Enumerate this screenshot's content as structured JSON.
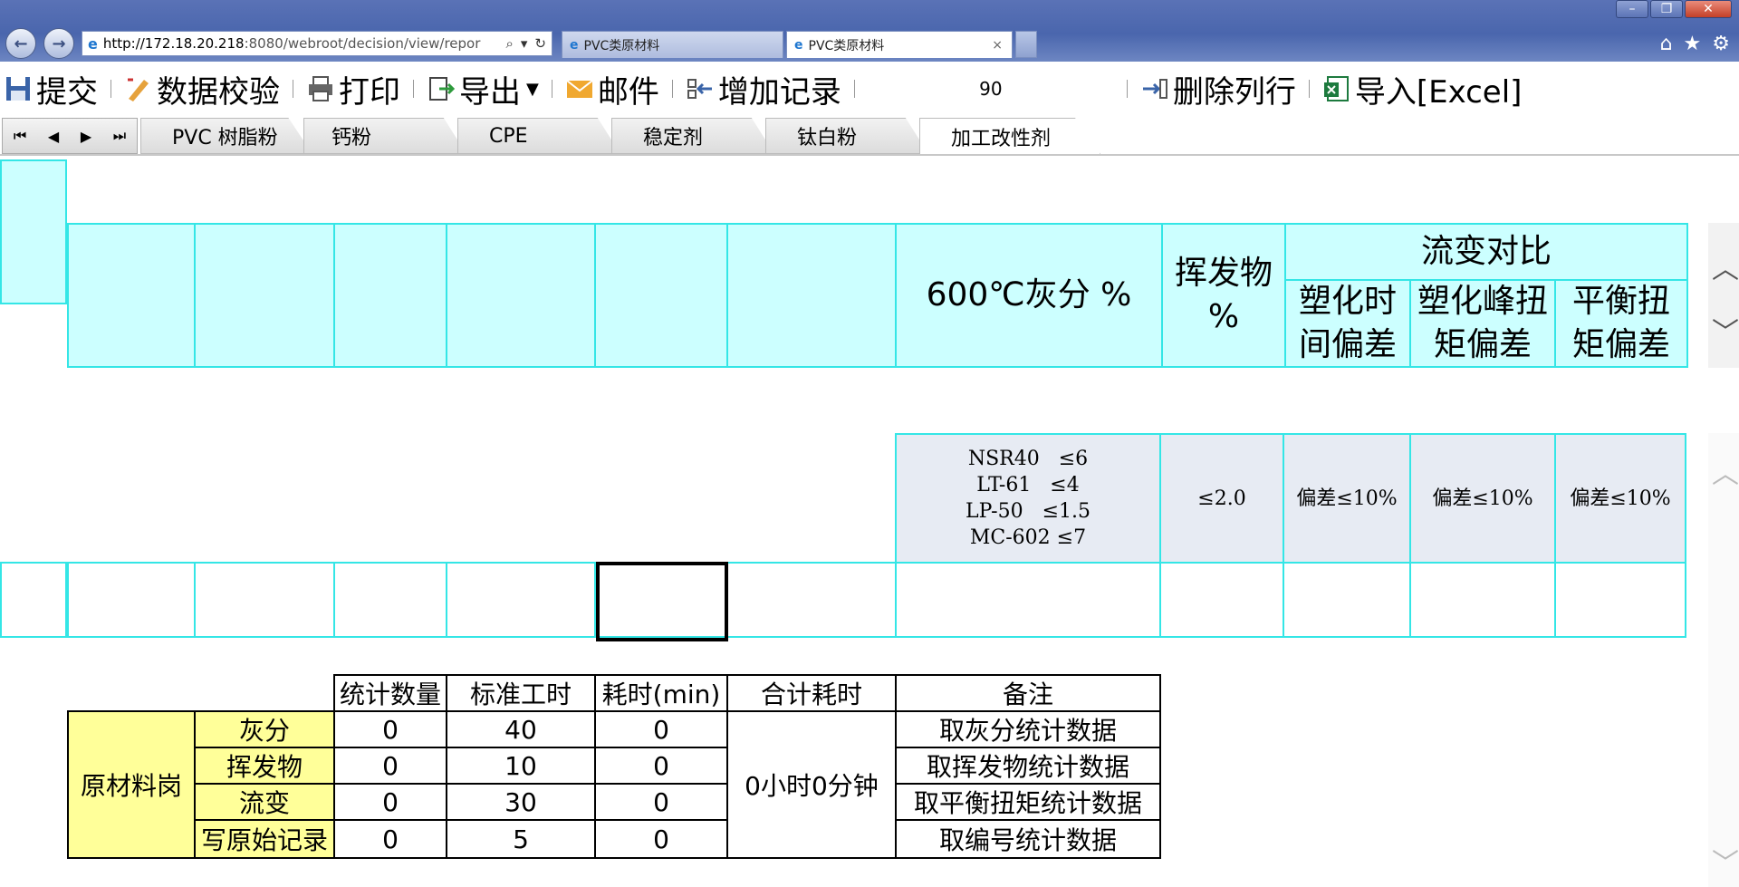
{
  "browser": {
    "address_url_host": "http://172.18.20.218",
    "address_url_rest": ":8080/webroot/decision/view/repor",
    "tabs": [
      {
        "title": "PVC类原材料"
      },
      {
        "title": "PVC类原材料"
      }
    ],
    "close_glyph": "×"
  },
  "toolbar": {
    "submit": "提交",
    "validate": "数据校验",
    "print": "打印",
    "export": "导出",
    "mail": "邮件",
    "add_record": "增加记录",
    "zoom_value": "90",
    "delete_row": "删除列行",
    "import_excel": "导入[Excel]"
  },
  "sheet_tabs": [
    {
      "label": "PVC 树脂粉",
      "active": false
    },
    {
      "label": "钙粉",
      "active": false
    },
    {
      "label": "CPE",
      "active": false
    },
    {
      "label": "稳定剂",
      "active": false
    },
    {
      "label": "钛白粉",
      "active": false
    },
    {
      "label": "加工改性剂",
      "active": true
    }
  ],
  "grid": {
    "header": {
      "ash": "600℃灰分 %",
      "volatile_line1": "挥发物",
      "volatile_line2": "%",
      "rheology": "流变对比",
      "plast_time_line1": "塑化时",
      "plast_time_line2": "间偏差",
      "peak_torque_line1": "塑化峰扭",
      "peak_torque_line2": "矩偏差",
      "balance_torque_line1": "平衡扭",
      "balance_torque_line2": "矩偏差"
    },
    "criteria": {
      "ash_lines": [
        "NSR40   ≤6",
        "LT-61   ≤4",
        "LP-50   ≤1.5",
        "MC-602 ≤7"
      ],
      "volatile": "≤2.0",
      "plast_time": "偏差≤10%",
      "peak_torque": "偏差≤10%",
      "balance_torque": "偏差≤10%"
    }
  },
  "summary": {
    "headers": [
      "统计数量",
      "标准工时",
      "耗时(min)",
      "合计耗时",
      "备注"
    ],
    "group_label": "原材料岗",
    "total": "0小时0分钟",
    "rows": [
      {
        "item": "灰分",
        "count": "0",
        "std": "40",
        "time": "0",
        "note": "取灰分统计数据"
      },
      {
        "item": "挥发物",
        "count": "0",
        "std": "10",
        "time": "0",
        "note": "取挥发物统计数据"
      },
      {
        "item": "流变",
        "count": "0",
        "std": "30",
        "time": "0",
        "note": "取平衡扭矩统计数据"
      },
      {
        "item": "写原始记录",
        "count": "0",
        "std": "5",
        "time": "0",
        "note": "取编号统计数据"
      }
    ]
  }
}
